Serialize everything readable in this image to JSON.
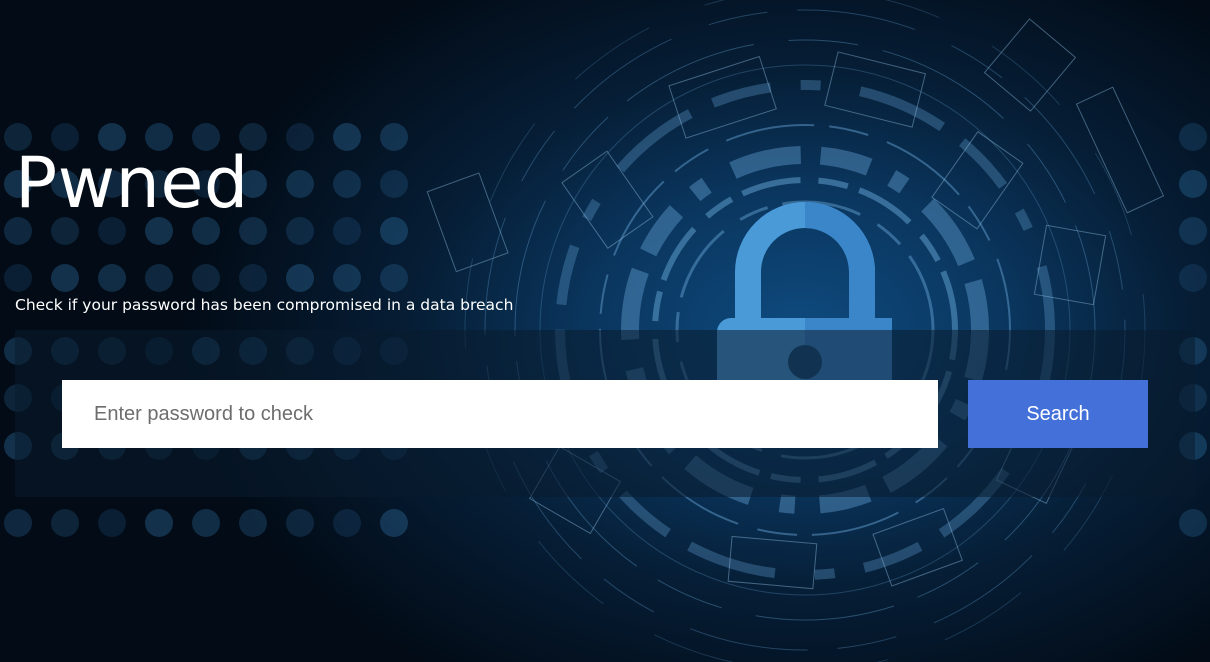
{
  "hero": {
    "title": "Pwned",
    "subtitle": "Check if your password has been compromised in a data breach"
  },
  "search": {
    "placeholder": "Enter password to check",
    "button_label": "Search"
  },
  "theme": {
    "accent": "#4470d9",
    "background": "#020b16",
    "lock_color": "#4a9ad8"
  },
  "icons": {
    "background_art": "padlock-icon"
  }
}
